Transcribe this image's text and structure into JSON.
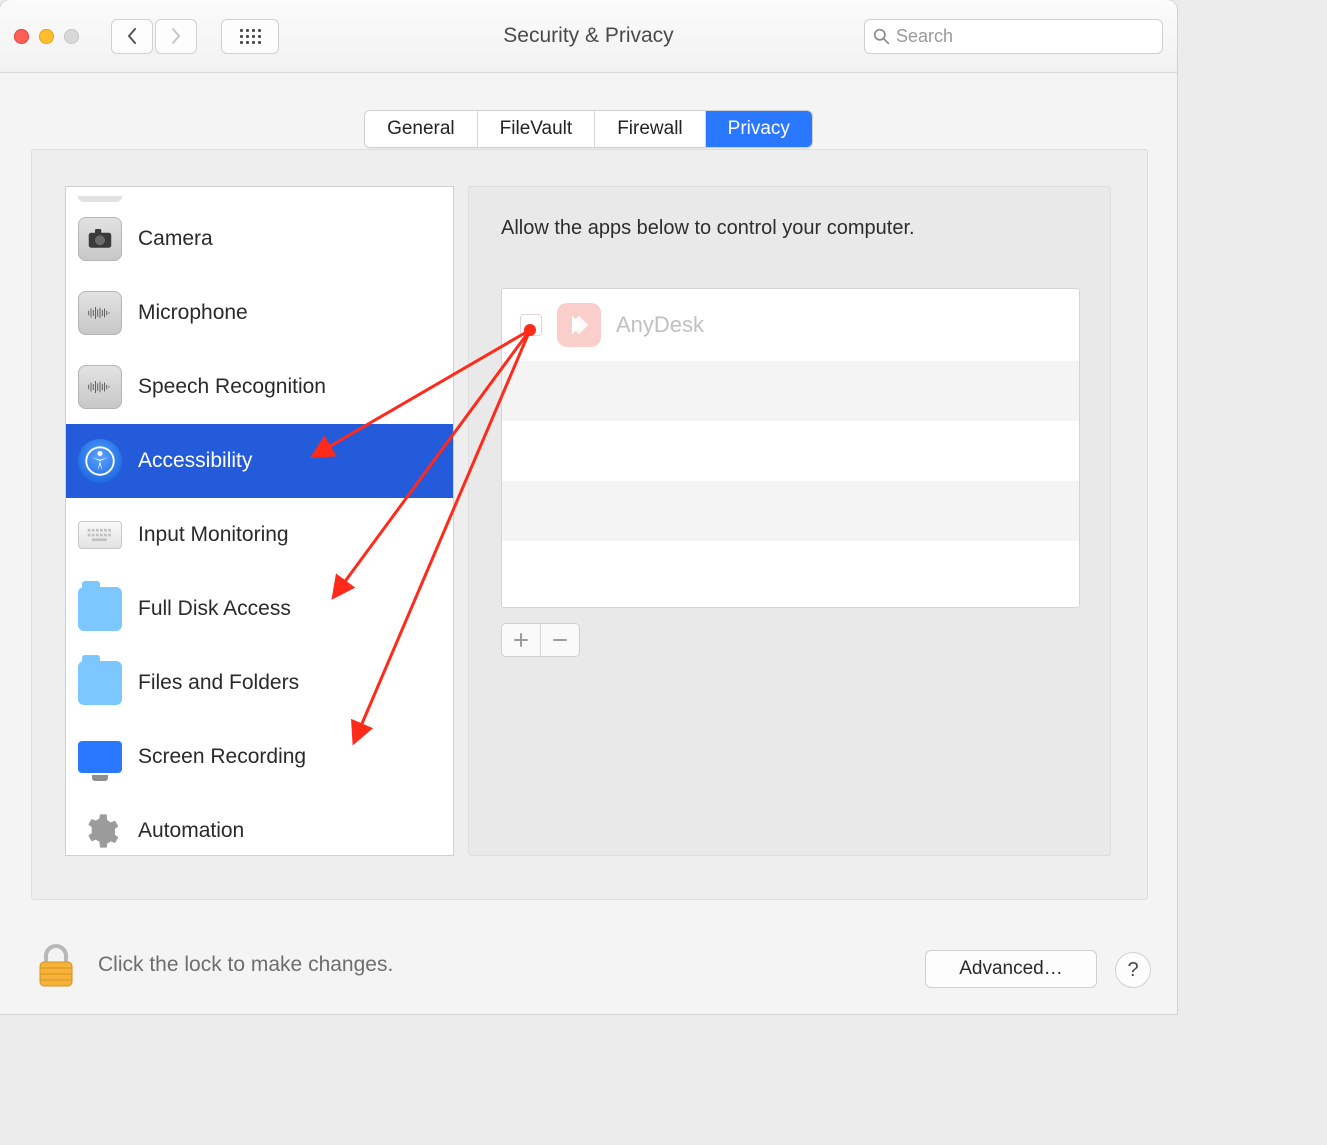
{
  "titlebar": {
    "title": "Security & Privacy",
    "search_placeholder": "Search"
  },
  "tabs": {
    "general": "General",
    "filevault": "FileVault",
    "firewall": "Firewall",
    "privacy": "Privacy",
    "active": "privacy"
  },
  "sidebar": {
    "items": {
      "camera": "Camera",
      "microphone": "Microphone",
      "speech": "Speech Recognition",
      "accessibility": "Accessibility",
      "input": "Input Monitoring",
      "fulldisk": "Full Disk Access",
      "files": "Files and Folders",
      "screen": "Screen Recording",
      "automation": "Automation"
    },
    "selected": "accessibility"
  },
  "detail": {
    "allow_label": "Allow the apps below to control your computer.",
    "apps": {
      "anydesk": {
        "name": "AnyDesk",
        "checked": false
      }
    }
  },
  "footer": {
    "lock_text": "Click the lock to make changes.",
    "advanced_label": "Advanced…",
    "help_label": "?"
  }
}
